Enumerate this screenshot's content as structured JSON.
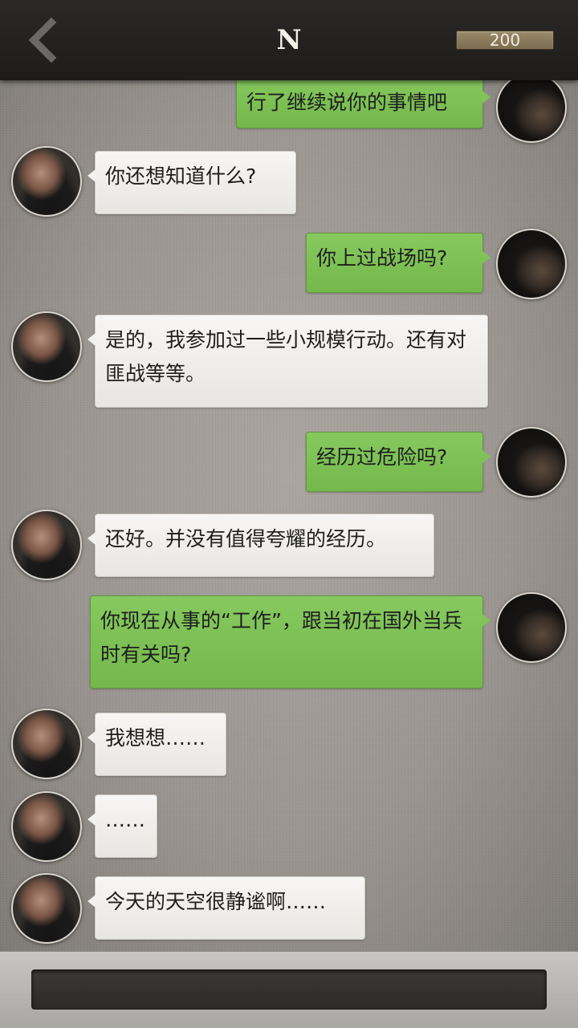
{
  "header": {
    "title": "N",
    "coins": "200",
    "back_icon": "chevron-left-icon"
  },
  "messages": [
    {
      "side": "right",
      "text": "行了继续说你的事情吧"
    },
    {
      "side": "left",
      "text": "你还想知道什么?"
    },
    {
      "side": "right",
      "text": "你上过战场吗?"
    },
    {
      "side": "left",
      "text": "是的，我参加过一些小规模行动。还有对匪战等等。"
    },
    {
      "side": "right",
      "text": "经历过危险吗?"
    },
    {
      "side": "left",
      "text": "还好。并没有值得夸耀的经历。"
    },
    {
      "side": "right",
      "text": "你现在从事的“工作”，跟当初在国外当兵时有关吗?"
    },
    {
      "side": "left",
      "text": "我想想……"
    },
    {
      "side": "left",
      "text": "……"
    },
    {
      "side": "left",
      "text": "今天的天空很静谧啊……"
    }
  ],
  "input": {
    "value": ""
  },
  "colors": {
    "player_bubble": "#7fc257",
    "npc_bubble": "#f2f1ee",
    "topbar": "#232120"
  }
}
